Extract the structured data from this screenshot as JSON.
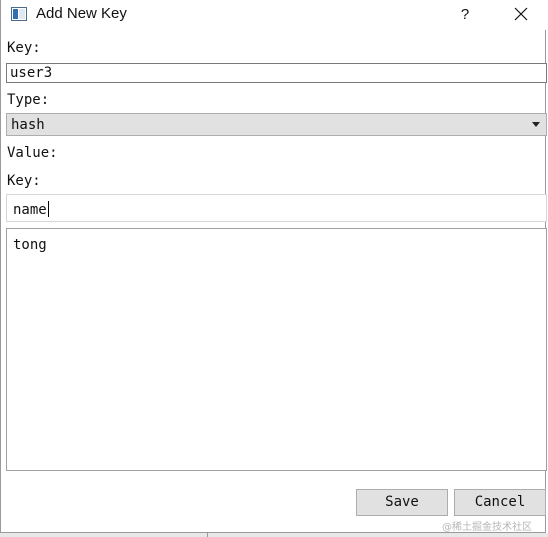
{
  "window": {
    "title": "Add New Key",
    "help_label": "?"
  },
  "form": {
    "key_label": "Key:",
    "key_value": "user3",
    "type_label": "Type:",
    "type_selected": "hash",
    "value_label": "Value:",
    "hash_key_label": "Key:",
    "hash_key_value": "name",
    "hash_value": "tong"
  },
  "buttons": {
    "save": "Save",
    "cancel": "Cancel"
  },
  "watermark": "@稀土掘金技术社区"
}
